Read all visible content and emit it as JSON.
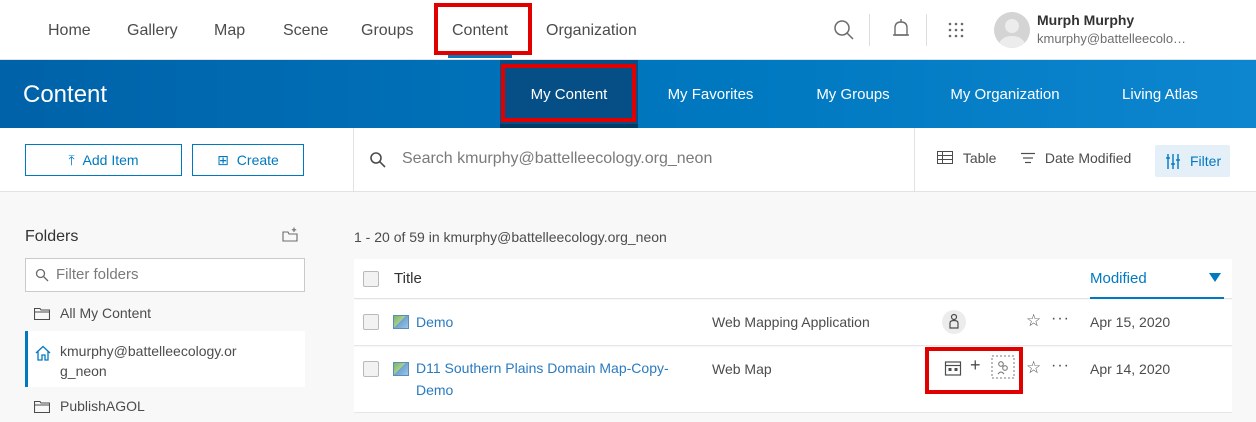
{
  "topnav": {
    "items": [
      "Home",
      "Gallery",
      "Map",
      "Scene",
      "Groups",
      "Content",
      "Organization"
    ],
    "user_name": "Murph Murphy",
    "user_email": "kmurphy@battelleecolo…"
  },
  "header": {
    "title": "Content",
    "tabs": [
      "My Content",
      "My Favorites",
      "My Groups",
      "My Organization",
      "Living Atlas"
    ]
  },
  "toolbar": {
    "add_item": "Add Item",
    "create": "Create",
    "search_placeholder": "Search kmurphy@battelleecology.org_neon",
    "table": "Table",
    "date_modified": "Date Modified",
    "filter": "Filter"
  },
  "sidebar": {
    "title": "Folders",
    "filter_placeholder": "Filter folders",
    "folders": [
      "All My Content",
      "kmurphy@battelleecology.or",
      "g_neon",
      "PublishAGOL"
    ]
  },
  "list": {
    "count_text": "1 - 20 of 59 in kmurphy@battelleecology.org_neon",
    "col_title": "Title",
    "col_modified": "Modified",
    "rows": [
      {
        "title": "Demo",
        "type": "Web Mapping Application",
        "date": "Apr 15, 2020"
      },
      {
        "title": "D11 Southern Plains Domain Map-Copy-",
        "title2": "Demo",
        "type": "Web Map",
        "date": "Apr 14, 2020"
      }
    ]
  },
  "colors": {
    "accent": "#0079c1",
    "highlight": "#e00000",
    "header_active": "#054f86"
  }
}
